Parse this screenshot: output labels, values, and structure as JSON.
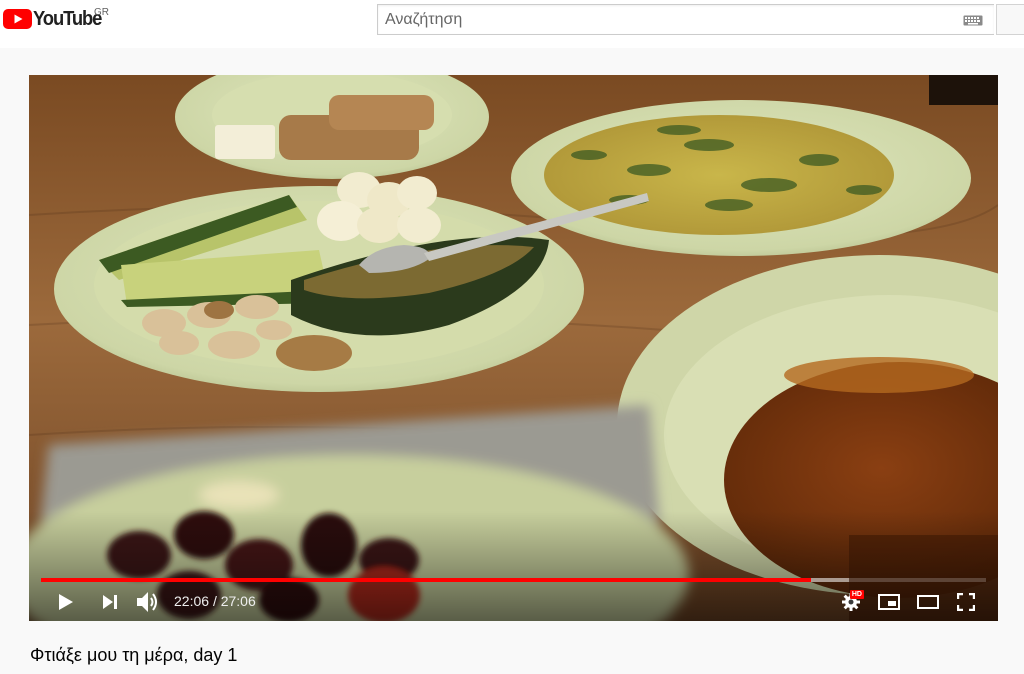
{
  "masthead": {
    "logo_text": "YouTube",
    "country_code": "GR",
    "brand_color": "#ff0000",
    "search": {
      "placeholder": "Αναζήτηση",
      "value": ""
    },
    "icons": {
      "keyboard": "keyboard-icon",
      "search_button": "search-button"
    }
  },
  "player": {
    "time": {
      "current": "22:06",
      "separator": "/",
      "duration": "27:06"
    },
    "progress": {
      "played_fraction": 0.815,
      "buffered_fraction": 0.855,
      "played_color": "#ff0000"
    },
    "controls": {
      "play": "play-icon",
      "next": "next-icon",
      "volume": "volume-icon",
      "settings": "settings-icon",
      "settings_badge": "HD",
      "miniplayer": "miniplayer-icon",
      "theater": "theater-mode-icon",
      "fullscreen": "fullscreen-icon"
    }
  },
  "video": {
    "title": "Φτιάξε μου τη μέρα, day 1"
  }
}
